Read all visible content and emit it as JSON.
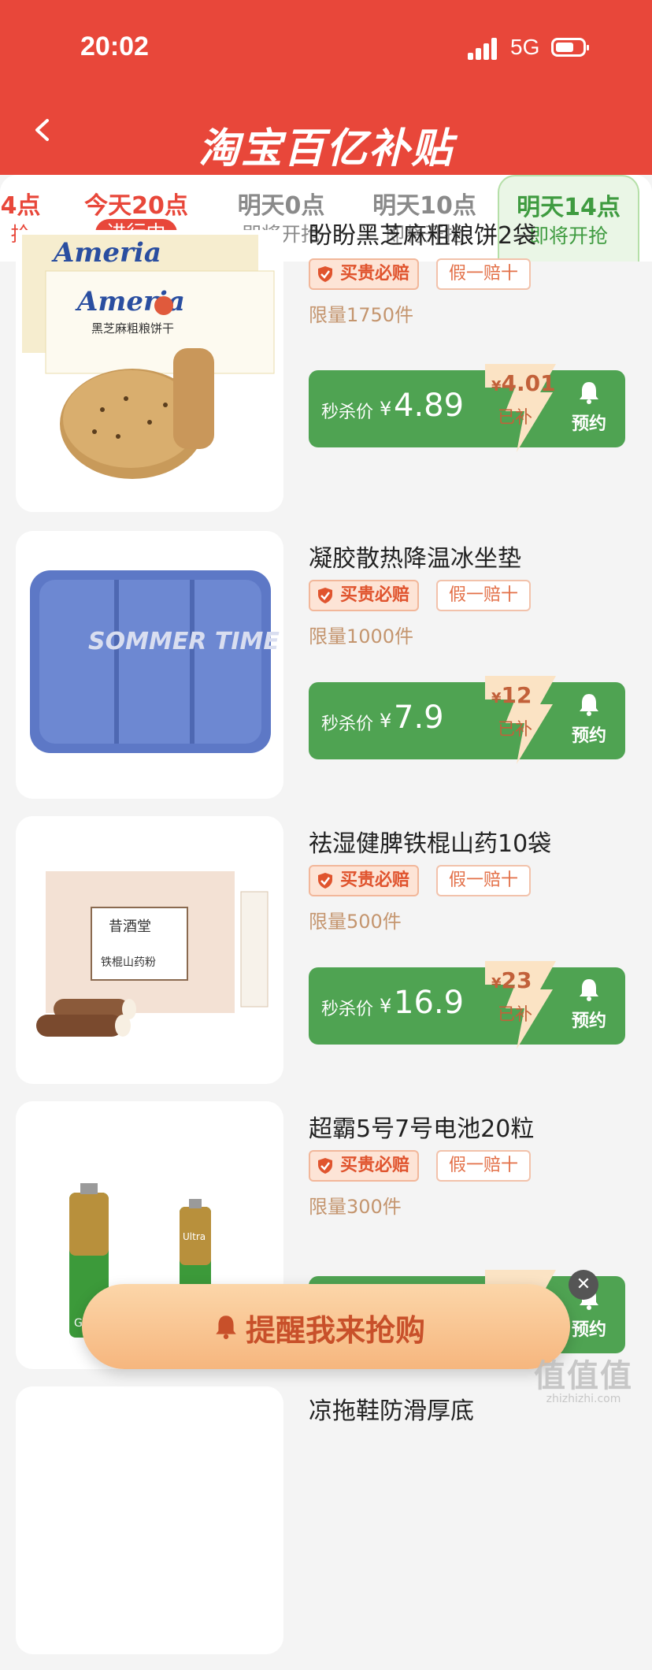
{
  "status_bar": {
    "time": "20:02",
    "network": "5G"
  },
  "header": {
    "title": "淘宝百亿补贴"
  },
  "tabs": [
    {
      "line1": "4点",
      "line2": "抢",
      "state": "past"
    },
    {
      "line1": "今天20点",
      "line2": "进行中",
      "state": "active"
    },
    {
      "line1": "明天0点",
      "line2": "即将开抢",
      "state": "upcoming"
    },
    {
      "line1": "明天10点",
      "line2": "即将开抢",
      "state": "upcoming"
    },
    {
      "line1": "明天14点",
      "line2": "即将开抢",
      "state": "highlight"
    }
  ],
  "badges": {
    "guarantee": "买贵必赔",
    "fake": "假一赔十"
  },
  "price_label": "秒杀价",
  "currency": "¥",
  "subsidy_label": "已补",
  "remind_label": "预约",
  "products": [
    {
      "title": "盼盼黑芝麻粗粮饼2袋",
      "limit": "限量1750件",
      "price": "4.89",
      "subsidy": "4.01",
      "image_brand": "Ameria",
      "image_text": "黑芝麻粗粮饼干"
    },
    {
      "title": "凝胶散热降温冰坐垫",
      "limit": "限量1000件",
      "price": "7.9",
      "subsidy": "12",
      "image_text": "SOMMER TIME"
    },
    {
      "title": "祛湿健脾铁棍山药10袋",
      "limit": "限量500件",
      "price": "16.9",
      "subsidy": "23",
      "image_brand": "昔酒堂",
      "image_text": "铁棍山药粉"
    },
    {
      "title": "超霸5号7号电池20粒",
      "limit": "限量300件",
      "price": "",
      "subsidy": "",
      "image_brand": "GP超霸",
      "image_text": "Ultra"
    },
    {
      "title": "凉拖鞋防滑厚底"
    }
  ],
  "cta": {
    "label": "提醒我来抢购"
  },
  "watermark": {
    "logo": "值值值",
    "url": "zhizhizhi.com"
  }
}
